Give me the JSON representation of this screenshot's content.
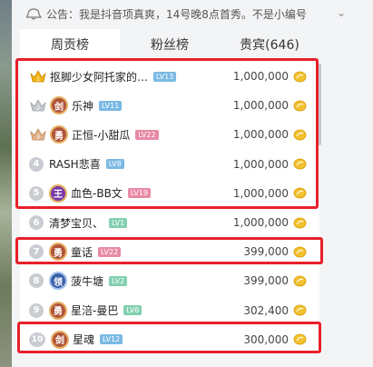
{
  "notice": {
    "icon": "announcement-bell-icon",
    "text": "公告：我是抖音项真爽，14号晚8点首秀。不是小编号"
  },
  "tabs": [
    {
      "label": "周贡榜",
      "active": true
    },
    {
      "label": "粉丝榜",
      "active": false
    },
    {
      "label": "贵宾(646)",
      "active": false
    }
  ],
  "rows": [
    {
      "rank": "1",
      "rank_icon": "gold-crown-icon",
      "badge_text": "",
      "name": "抠脚少女阿托家的…",
      "level": "LV13",
      "level_color": "#7ab9e3",
      "amount": "1,000,000",
      "coin_icon": "gold-coin-icon"
    },
    {
      "rank": "2",
      "rank_icon": "silver-crown-icon",
      "badge_text": "剑",
      "badge_color": "#b0553a",
      "name": "乐神",
      "level": "LV11",
      "level_color": "#7ab9e3",
      "amount": "1,000,000",
      "coin_icon": "gold-coin-icon"
    },
    {
      "rank": "3",
      "rank_icon": "bronze-crown-icon",
      "badge_text": "勇",
      "badge_color": "#b0553a",
      "name": "正恒-小甜瓜",
      "level": "LV22",
      "level_color": "#e889a5",
      "amount": "1,000,000",
      "coin_icon": "gold-coin-icon"
    },
    {
      "rank": "4",
      "rank_icon": "",
      "badge_text": "",
      "name": "RASH悲喜",
      "level": "LV8",
      "level_color": "#7ab9e3",
      "amount": "1,000,000",
      "coin_icon": "gold-coin-icon"
    },
    {
      "rank": "5",
      "rank_icon": "",
      "badge_text": "王",
      "badge_color": "#7a3aa8",
      "name": "血色-BB文",
      "level": "LV19",
      "level_color": "#e889a5",
      "amount": "1,000,000",
      "coin_icon": "gold-coin-icon"
    },
    {
      "rank": "6",
      "rank_icon": "",
      "badge_text": "",
      "name": "清梦宝贝、",
      "level": "LV1",
      "level_color": "#82d0b0",
      "amount": "1,000,000",
      "coin_icon": "gold-coin-icon"
    },
    {
      "rank": "7",
      "rank_icon": "",
      "badge_text": "勇",
      "badge_color": "#b0553a",
      "name": "童话",
      "level": "LV22",
      "level_color": "#e889a5",
      "amount": "399,000",
      "coin_icon": "gold-coin-icon"
    },
    {
      "rank": "8",
      "rank_icon": "",
      "badge_text": "领",
      "badge_color": "#3b5ea8",
      "name": "菠牛塘",
      "level": "LV2",
      "level_color": "#82d0b0",
      "amount": "399,000",
      "coin_icon": "gold-coin-icon"
    },
    {
      "rank": "9",
      "rank_icon": "",
      "badge_text": "勇",
      "badge_color": "#b0553a",
      "name": "星涪-曼巴",
      "level": "LV6",
      "level_color": "#82d0b0",
      "amount": "302,400",
      "coin_icon": "gold-coin-icon"
    },
    {
      "rank": "10",
      "rank_icon": "",
      "badge_text": "剑",
      "badge_color": "#b0553a",
      "name": "星魂",
      "level": "LV12",
      "level_color": "#7ab9e3",
      "amount": "300,000",
      "coin_icon": "gold-coin-icon"
    }
  ]
}
